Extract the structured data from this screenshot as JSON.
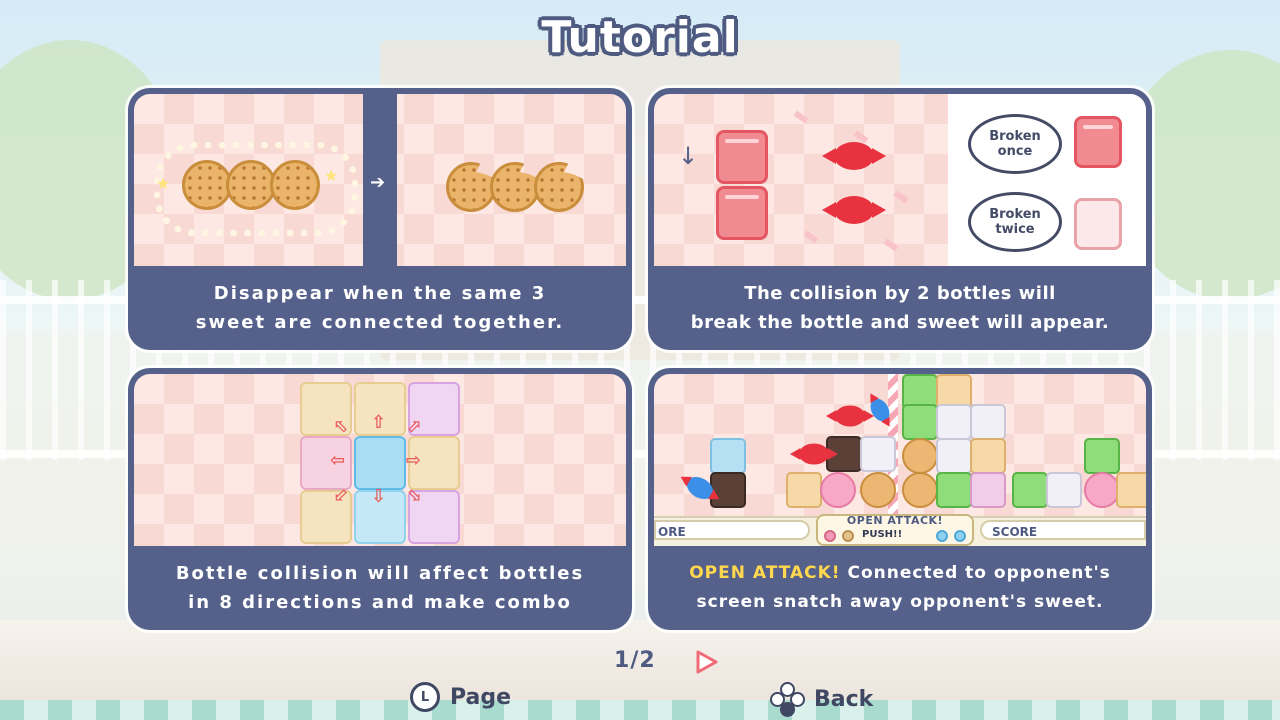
{
  "title": "Tutorial",
  "panels": [
    {
      "caption_line1": "Disappear when the same 3",
      "caption_line2": "sweet are connected together."
    },
    {
      "caption_line1": "The collision by 2 bottles will",
      "caption_line2": "break the bottle and sweet will appear.",
      "bubble_once_line1": "Broken",
      "bubble_once_line2": "once",
      "bubble_twice_line1": "Broken",
      "bubble_twice_line2": "twice"
    },
    {
      "caption_line1": "Bottle collision will affect bottles",
      "caption_line2": "in 8 directions and make combo"
    },
    {
      "caption_highlight": "OPEN ATTACK!",
      "caption_line1_rest": " Connected to opponent's",
      "caption_line2": "screen snatch away opponent's sweet.",
      "score_left": "ORE",
      "score_right": "SCORE",
      "open_attack_label": "OPEN ATTACK!",
      "push_label": "PUSH!!"
    }
  ],
  "pager": {
    "current": "1",
    "separator": "/",
    "total": "2"
  },
  "controls": {
    "page_button_glyph": "L",
    "page_label": "Page",
    "back_label": "Back"
  },
  "colors": {
    "panel_bg": "#55618a",
    "title_outline": "#4e5a80",
    "highlight": "#ffd84d",
    "next_arrow": "#f06b76"
  }
}
